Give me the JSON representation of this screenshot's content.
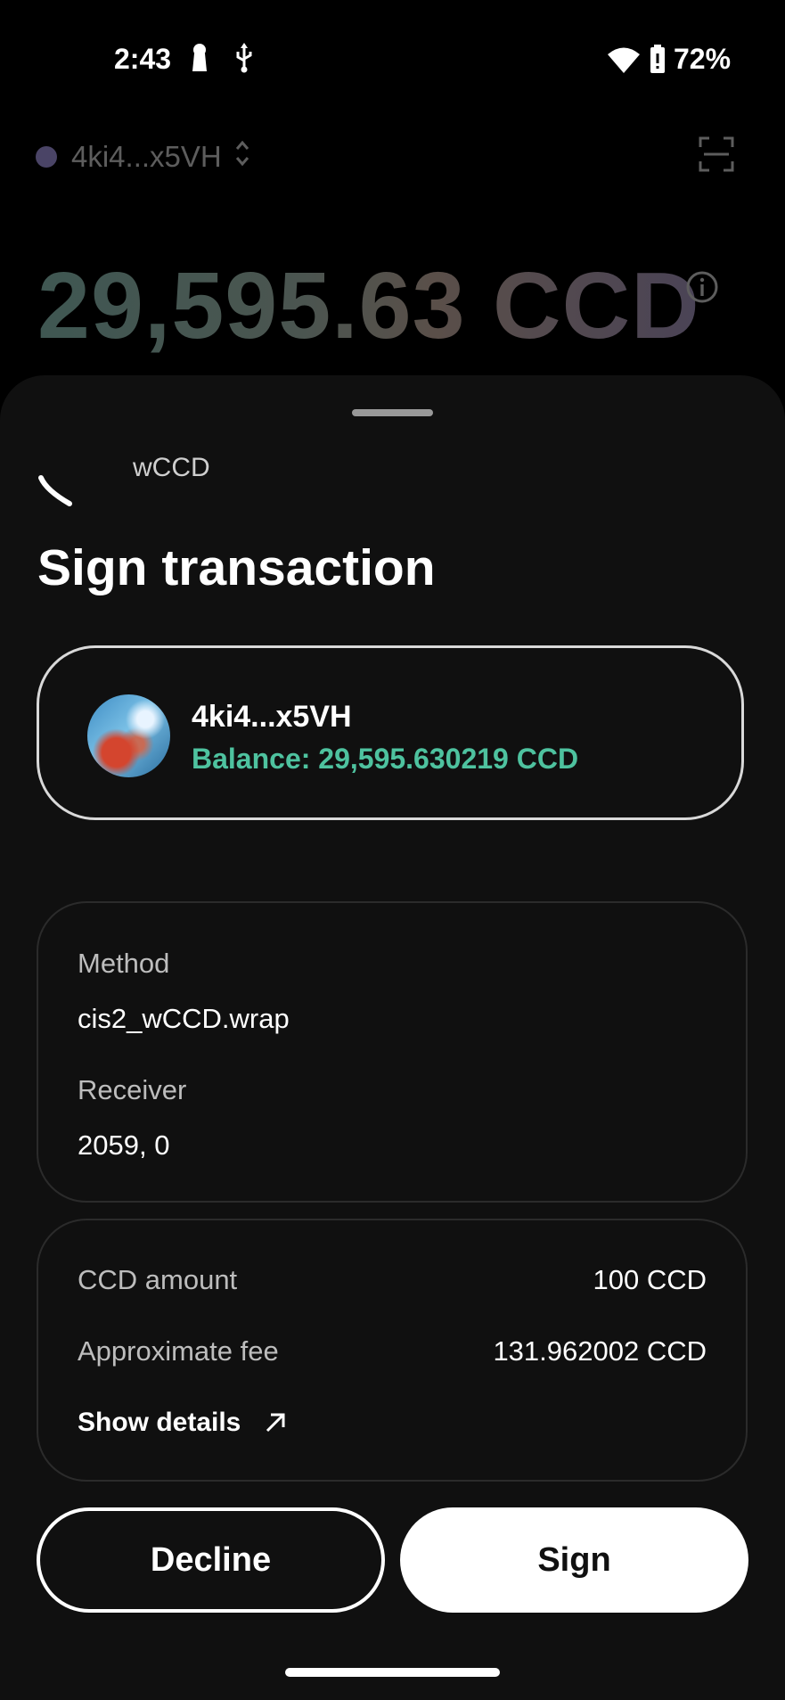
{
  "status_bar": {
    "time": "2:43",
    "battery": "72%"
  },
  "wallet": {
    "account": "4ki4...x5VH",
    "balance": "29,595.63 CCD"
  },
  "sheet": {
    "app_name": "wCCD",
    "title": "Sign transaction",
    "account_card": {
      "name": "4ki4...x5VH",
      "balance": "Balance: 29,595.630219 CCD"
    },
    "details": {
      "method_label": "Method",
      "method_value": "cis2_wCCD.wrap",
      "receiver_label": "Receiver",
      "receiver_value": "2059, 0"
    },
    "amounts": {
      "amount_label": "CCD amount",
      "amount_value": "100 CCD",
      "fee_label": "Approximate fee",
      "fee_value": "131.962002 CCD",
      "show_details": "Show details"
    },
    "buttons": {
      "decline": "Decline",
      "sign": "Sign"
    }
  },
  "colors": {
    "accent_green": "#4ec29f",
    "sheet_bg": "#101010"
  },
  "icons": [
    "key-icon",
    "usb-icon",
    "wifi-icon",
    "battery-icon",
    "chevron-updown-icon",
    "scan-icon",
    "info-icon",
    "loading-arc-icon",
    "arrow-up-right-icon"
  ]
}
